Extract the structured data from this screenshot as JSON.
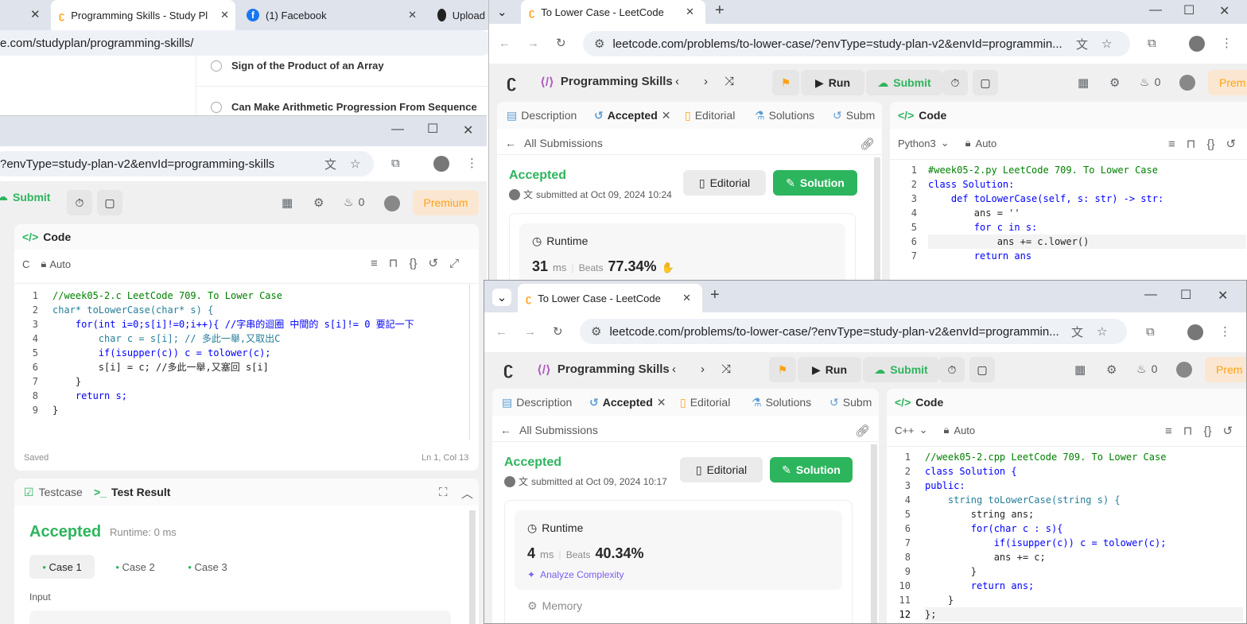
{
  "back_window": {
    "tabs": [
      {
        "label": "Programming Skills - Study Pl",
        "icon": "leetcode-icon"
      },
      {
        "label": "(1) Facebook",
        "icon": "facebook-icon"
      },
      {
        "label": "Upload",
        "icon": "github-icon"
      }
    ],
    "url": "e.com/studyplan/programming-skills/",
    "list_items": [
      "Sign of the Product of an Array",
      "Can Make Arithmetic Progression From Sequence"
    ]
  },
  "left_window": {
    "url": "?envType=study-plan-v2&envId=programming-skills",
    "submit_label": "Submit",
    "streak": "0",
    "premium_label": "Premium",
    "code_title": "Code",
    "lang": "C",
    "mode": "Auto",
    "code_lines": [
      "//week05-2.c LeetCode 709. To Lower Case",
      "char* toLowerCase(char* s) {",
      "    for(int i=0;s[i]!=0;i++){ //字串的迴圈 中間的 s[i]!= 0 要記一下",
      "        char c = s[i]; // 多此一舉,又取出C",
      "        if(isupper(c)) c = tolower(c);",
      "        s[i] = c; //多此一舉,又塞回 s[i]",
      "    }",
      "    return s;",
      "}"
    ],
    "saved_label": "Saved",
    "cursor_pos": "Ln 1, Col 13",
    "testcase_label": "Testcase",
    "test_result_label": "Test Result",
    "result_status": "Accepted",
    "runtime_text": "Runtime: 0 ms",
    "cases": [
      "Case 1",
      "Case 2",
      "Case 3"
    ],
    "input_label": "Input"
  },
  "top_right_window": {
    "tab_title": "To Lower Case - LeetCode",
    "url": "leetcode.com/problems/to-lower-case/?envType=study-plan-v2&envId=programmin...",
    "study_plan": "Programming Skills",
    "run_label": "Run",
    "submit_label": "Submit",
    "streak": "0",
    "premium_label": "Prem",
    "panel_tabs": [
      "Description",
      "Accepted",
      "Editorial",
      "Solutions",
      "Subm"
    ],
    "all_submissions": "All Submissions",
    "status": "Accepted",
    "submitted_text": "submitted at Oct 09, 2024 10:24",
    "editorial_btn": "Editorial",
    "solution_btn": "Solution",
    "runtime_label": "Runtime",
    "runtime_value": "31",
    "runtime_unit": "ms",
    "beats_label": "Beats",
    "beats_value": "77.34%",
    "code_title": "Code",
    "lang": "Python3",
    "mode": "Auto",
    "code_lines": [
      "#week05-2.py LeetCode 709. To Lower Case",
      "class Solution:",
      "    def toLowerCase(self, s: str) -> str:",
      "        ans = ''",
      "        for c in s:",
      "            ans += c.lower()",
      "        return ans"
    ]
  },
  "front_window": {
    "tab_title": "To Lower Case - LeetCode",
    "url": "leetcode.com/problems/to-lower-case/?envType=study-plan-v2&envId=programmin...",
    "study_plan": "Programming Skills",
    "run_label": "Run",
    "submit_label": "Submit",
    "streak": "0",
    "premium_label": "Prem",
    "panel_tabs": [
      "Description",
      "Accepted",
      "Editorial",
      "Solutions",
      "Subm"
    ],
    "all_submissions": "All Submissions",
    "status": "Accepted",
    "submitted_text": "submitted at Oct 09, 2024 10:17",
    "editorial_btn": "Editorial",
    "solution_btn": "Solution",
    "runtime_label": "Runtime",
    "runtime_value": "4",
    "runtime_unit": "ms",
    "beats_label": "Beats",
    "beats_value": "40.34%",
    "analyze_label": "Analyze Complexity",
    "memory_label": "Memory",
    "code_title": "Code",
    "lang": "C++",
    "mode": "Auto",
    "code_lines": [
      "//week05-2.cpp LeetCode 709. To Lower Case",
      "class Solution {",
      "public:",
      "    string toLowerCase(string s) {",
      "        string ans;",
      "        for(char c : s){",
      "            if(isupper(c)) c = tolower(c);",
      "            ans += c;",
      "        }",
      "        return ans;",
      "    }",
      "};"
    ]
  },
  "colors": {
    "accent_green": "#2db55d",
    "leetcode_orange": "#ffa116",
    "tab_strip": "#dfe3eb"
  }
}
